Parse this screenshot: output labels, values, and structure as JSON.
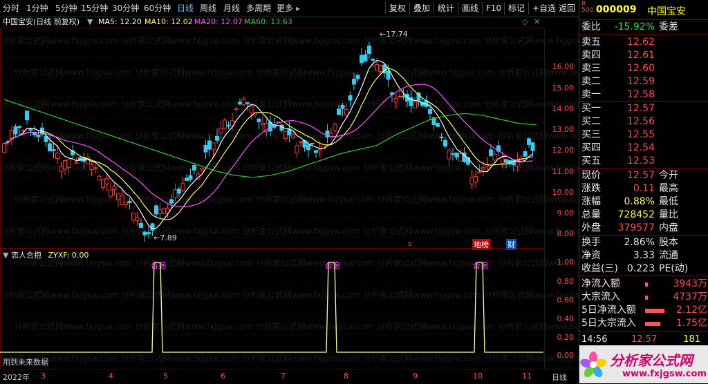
{
  "toolbar": {
    "periods": [
      "分时",
      "1分钟",
      "5分钟",
      "15分钟",
      "30分钟",
      "60分钟",
      "日线",
      "周线",
      "月线",
      "多周期",
      "更多"
    ],
    "active": "日线",
    "buttons": [
      "复权",
      "叠加",
      "统计",
      "画线",
      "F10",
      "标记",
      "+自选",
      "返回"
    ]
  },
  "info": {
    "title": "中国宝安(日线 前复权)",
    "ma5": "MA5: 12.20",
    "ma10": "MA10: 12.02",
    "ma20": "MA20: 12.07",
    "ma60": "MA60: 13.63",
    "colors": {
      "ma5": "#ffffff",
      "ma10": "#ffff66",
      "ma20": "#ff55ff",
      "ma60": "#33cc33"
    }
  },
  "price_axis": [
    "16.00",
    "15.00",
    "14.00",
    "13.00",
    "12.00",
    "11.00",
    "10.00",
    "9.00",
    "8.00"
  ],
  "indicator_axis": [
    "1.00",
    "0.80",
    "0.60",
    "0.40",
    "0.20",
    "0.00"
  ],
  "annotations": {
    "high": "17.74",
    "low": "7.89"
  },
  "markers": {
    "s": "s",
    "dilong": "地榜",
    "cai": "财"
  },
  "indicator": {
    "name": "恋人合抱",
    "value_label": "ZYXF: 0.00",
    "signal_label": "合抱",
    "footnote": "用到未来数据"
  },
  "x_axis": [
    "2022年",
    "3",
    "4",
    "5",
    "6",
    "7",
    "8",
    "9",
    "10",
    "11",
    "日线"
  ],
  "chart_data": {
    "type": "candlestick",
    "title": "中国宝安(日线 前复权)",
    "ylim": [
      7.5,
      18.5
    ],
    "high_marker": 17.74,
    "low_marker": 7.89,
    "close_path": [
      12.8,
      13.1,
      13.4,
      13.6,
      13.2,
      12.9,
      12.4,
      12.1,
      11.6,
      11.9,
      12.0,
      11.8,
      11.3,
      11.0,
      10.6,
      10.2,
      9.9,
      9.5,
      8.6,
      8.2,
      8.9,
      9.4,
      9.9,
      10.4,
      10.8,
      11.2,
      11.7,
      12.3,
      12.8,
      13.6,
      14.0,
      14.4,
      14.9,
      14.2,
      13.9,
      13.6,
      13.5,
      13.2,
      12.9,
      12.6,
      12.3,
      12.5,
      12.6,
      13.2,
      13.9,
      14.6,
      15.6,
      16.6,
      17.3,
      16.8,
      16.0,
      15.3,
      14.9,
      14.7,
      14.9,
      14.6,
      14.2,
      13.4,
      12.4,
      12.1,
      11.9,
      11.4,
      11.1,
      11.6,
      12.2,
      12.5,
      12.0,
      11.8,
      12.1,
      12.57
    ],
    "ma60_path": [
      14.9,
      14.6,
      14.3,
      14.0,
      13.7,
      13.4,
      13.1,
      12.8,
      12.5,
      12.2,
      11.9,
      11.6,
      11.3,
      11.1,
      11.0,
      11.1,
      11.3,
      11.6,
      11.9,
      12.2,
      12.4,
      12.6,
      13.1,
      13.5,
      13.9,
      14.1,
      14.2,
      14.1,
      13.9,
      13.7,
      13.63
    ],
    "signals_x": [
      "5",
      "8",
      "10"
    ],
    "indicator_value": 0.0
  },
  "quote": {
    "code": "000009",
    "name": "中国宝安",
    "weibi_label": "委比",
    "weibi": "-15.92%",
    "weicha_label": "委差",
    "asks": [
      {
        "l": "卖五",
        "p": "12.62"
      },
      {
        "l": "卖四",
        "p": "12.61"
      },
      {
        "l": "卖三",
        "p": "12.60"
      },
      {
        "l": "卖二",
        "p": "12.59"
      },
      {
        "l": "卖一",
        "p": "12.58"
      }
    ],
    "bids": [
      {
        "l": "买一",
        "p": "12.57"
      },
      {
        "l": "买二",
        "p": "12.56"
      },
      {
        "l": "买三",
        "p": "12.55"
      },
      {
        "l": "买四",
        "p": "12.54"
      },
      {
        "l": "买五",
        "p": "12.53"
      }
    ],
    "stats": [
      {
        "l": "现价",
        "v": "12.57",
        "l2": "今开"
      },
      {
        "l": "涨跌",
        "v": "0.11",
        "l2": "最高"
      },
      {
        "l": "涨幅",
        "v": "0.88%",
        "l2": "最低"
      },
      {
        "l": "总量",
        "v": "728452",
        "l2": "量比"
      },
      {
        "l": "外盘",
        "v": "379577",
        "l2": "内盘"
      }
    ],
    "stats2": [
      {
        "l": "换手",
        "v": "2.86%",
        "l2": "股本"
      },
      {
        "l": "净资",
        "v": "3.33",
        "l2": "流通"
      },
      {
        "l": "收益(三)",
        "v": "0.223",
        "l2": "PE(动)"
      }
    ],
    "flows": [
      {
        "l": "净流入额",
        "v": "3943万"
      },
      {
        "l": "大宗流入",
        "v": "4737万"
      },
      {
        "l": "5日净流入额",
        "v": "2.12亿"
      },
      {
        "l": "5日大宗流入",
        "v": "1.75亿"
      }
    ],
    "tick": {
      "time": "14:56",
      "price": "12.57",
      "vol": "181"
    },
    "logo_text": "分析家公式网",
    "logo_url": "www.fxjgsw.com"
  }
}
